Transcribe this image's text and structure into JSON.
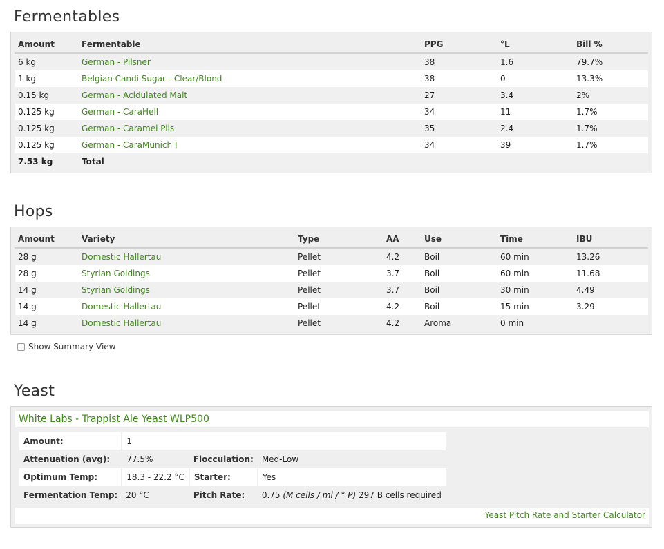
{
  "fermentables": {
    "title": "Fermentables",
    "headers": [
      "Amount",
      "Fermentable",
      "PPG",
      "°L",
      "Bill %"
    ],
    "rows": [
      {
        "amount": "6 kg",
        "name": "German - Pilsner",
        "ppg": "38",
        "lovibond": "1.6",
        "bill": "79.7%"
      },
      {
        "amount": "1 kg",
        "name": "Belgian Candi Sugar - Clear/Blond",
        "ppg": "38",
        "lovibond": "0",
        "bill": "13.3%"
      },
      {
        "amount": "0.15 kg",
        "name": "German - Acidulated Malt",
        "ppg": "27",
        "lovibond": "3.4",
        "bill": "2%"
      },
      {
        "amount": "0.125 kg",
        "name": "German - CaraHell",
        "ppg": "34",
        "lovibond": "11",
        "bill": "1.7%"
      },
      {
        "amount": "0.125 kg",
        "name": "German - Caramel Pils",
        "ppg": "35",
        "lovibond": "2.4",
        "bill": "1.7%"
      },
      {
        "amount": "0.125 kg",
        "name": "German - CaraMunich I",
        "ppg": "34",
        "lovibond": "39",
        "bill": "1.7%"
      }
    ],
    "total": {
      "amount": "7.53 kg",
      "label": "Total"
    }
  },
  "hops": {
    "title": "Hops",
    "headers": [
      "Amount",
      "Variety",
      "Type",
      "AA",
      "Use",
      "Time",
      "IBU"
    ],
    "rows": [
      {
        "amount": "28 g",
        "variety": "Domestic Hallertau",
        "type": "Pellet",
        "aa": "4.2",
        "use": "Boil",
        "time": "60 min",
        "ibu": "13.26"
      },
      {
        "amount": "28 g",
        "variety": "Styrian Goldings",
        "type": "Pellet",
        "aa": "3.7",
        "use": "Boil",
        "time": "60 min",
        "ibu": "11.68"
      },
      {
        "amount": "14 g",
        "variety": "Styrian Goldings",
        "type": "Pellet",
        "aa": "3.7",
        "use": "Boil",
        "time": "30 min",
        "ibu": "4.49"
      },
      {
        "amount": "14 g",
        "variety": "Domestic Hallertau",
        "type": "Pellet",
        "aa": "4.2",
        "use": "Boil",
        "time": "15 min",
        "ibu": "3.29"
      },
      {
        "amount": "14 g",
        "variety": "Domestic Hallertau",
        "type": "Pellet",
        "aa": "4.2",
        "use": "Aroma",
        "time": "0 min",
        "ibu": ""
      }
    ],
    "summary_label": "Show Summary View",
    "summary_checked": false
  },
  "yeast": {
    "title": "Yeast",
    "name": "White Labs - Trappist Ale Yeast WLP500",
    "amount_label": "Amount:",
    "amount": "1",
    "attenuation_label": "Attenuation (avg):",
    "attenuation": "77.5%",
    "flocculation_label": "Flocculation:",
    "flocculation": "Med-Low",
    "optimum_temp_label": "Optimum Temp:",
    "optimum_temp": "18.3 - 22.2 °C",
    "starter_label": "Starter:",
    "starter": "Yes",
    "fermentation_temp_label": "Fermentation Temp:",
    "fermentation_temp": "20 °C",
    "pitch_rate_label": "Pitch Rate:",
    "pitch_rate_value": "0.75",
    "pitch_rate_units": "(M cells / ml / ° P)",
    "pitch_rate_required": "297 B cells required",
    "calculator_link": "Yeast Pitch Rate and Starter Calculator"
  },
  "colors": {
    "link": "#3c8c14",
    "panel_bg": "#efefef",
    "row_alt": "#ffffff"
  }
}
